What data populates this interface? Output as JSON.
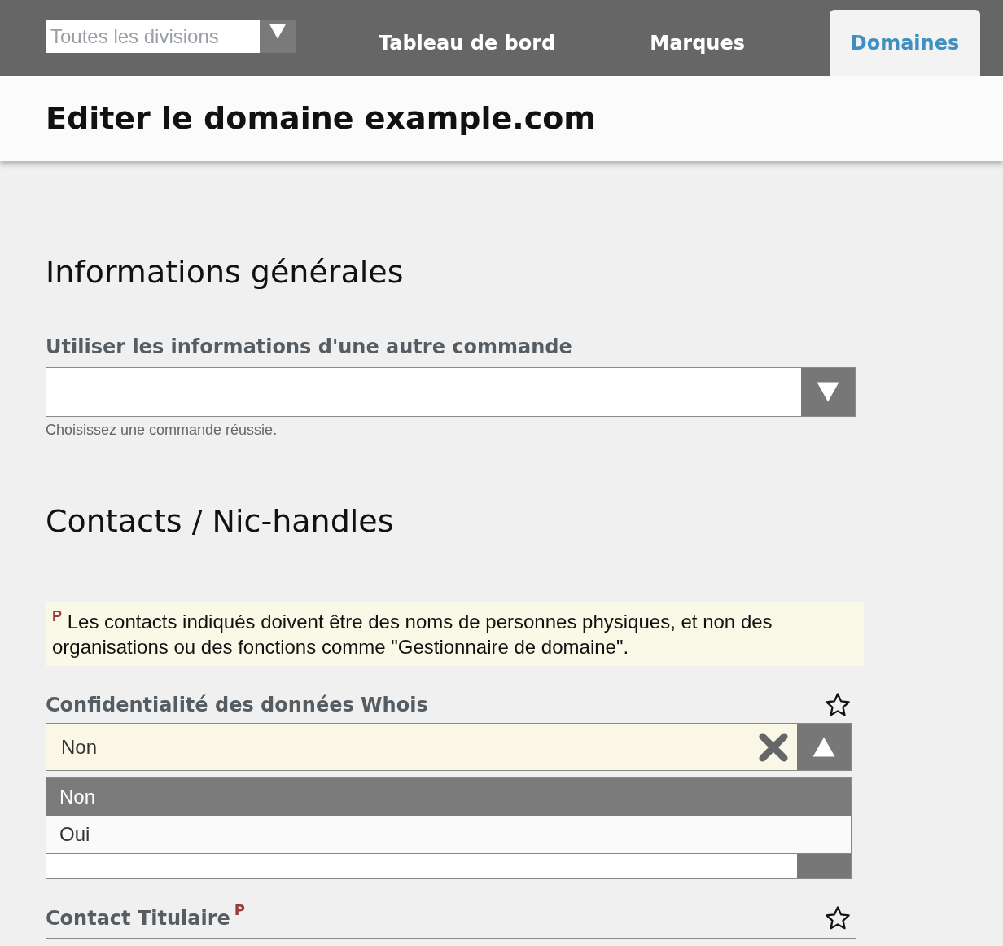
{
  "division_select": {
    "value": "Toutes les divisions"
  },
  "tabs": [
    {
      "label": "Tableau de bord",
      "selected": false
    },
    {
      "label": "Marques",
      "selected": false
    },
    {
      "label": "Domaines",
      "selected": true
    }
  ],
  "page_title": "Editer le domaine example.com",
  "sections": [
    {
      "title": "Informations générales"
    },
    {
      "title": "Contacts / Nic-handles"
    }
  ],
  "order_field": {
    "label": "Utiliser les informations d'une autre commande",
    "help": "Choisissez une commande réussie."
  },
  "notice": {
    "text": "$^{P}$ Les contacts indiqués doivent être des noms de personnes physiques, et non des organisations ou des fonctions comme \"Gestionnaire de domaine\"."
  },
  "whois_field": {
    "label": "Confidentialité des données Whois",
    "value": "Non",
    "expanded": true,
    "options": [
      {
        "label": "Non",
        "selected": true
      },
      {
        "label": "Oui",
        "selected": false
      }
    ]
  },
  "holder_field": {
    "label": "Contact Titulaire",
    "marker": "P"
  }
}
